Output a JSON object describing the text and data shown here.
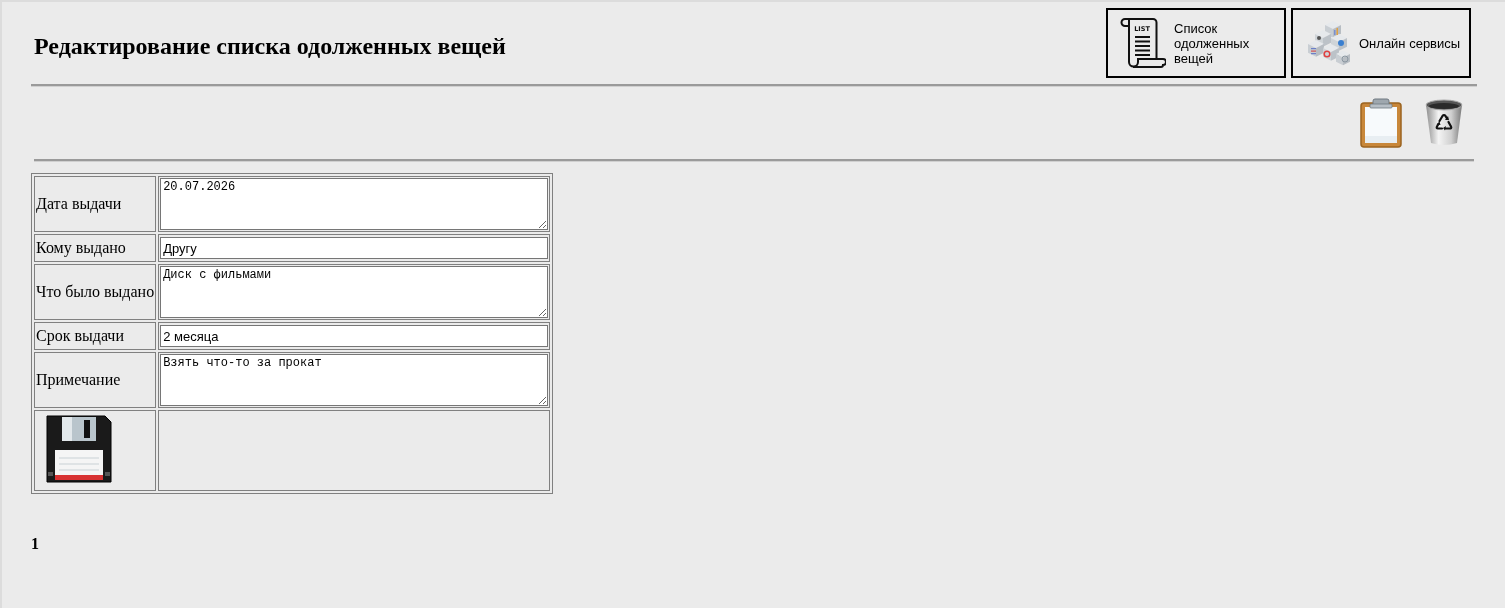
{
  "header": {
    "title": "Редактирование списка одолженных вещей"
  },
  "nav_buttons": [
    {
      "kind": "list",
      "label": "Список одолженных вещей",
      "icon_text": "LIST"
    },
    {
      "kind": "services",
      "label": "Онлайн сервисы"
    }
  ],
  "form": {
    "fields": [
      {
        "kind": "textarea",
        "label": "Дата выдачи",
        "value": "20.07.2026"
      },
      {
        "kind": "input",
        "label": "Кому выдано",
        "value": "Другу"
      },
      {
        "kind": "textarea",
        "label": "Что было выдано",
        "value": "Диск с фильмами"
      },
      {
        "kind": "input",
        "label": "Срок выдачи",
        "value": "2 месяца"
      },
      {
        "kind": "textarea",
        "label": "Примечание",
        "value": "Взять что-то за прокат"
      }
    ]
  },
  "pagination": {
    "page": "1"
  }
}
